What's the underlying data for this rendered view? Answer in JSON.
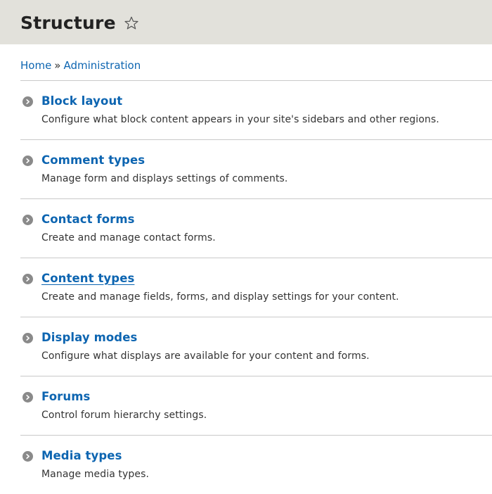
{
  "header": {
    "title": "Structure"
  },
  "breadcrumb": {
    "home": "Home",
    "separator": "»",
    "administration": "Administration"
  },
  "items": [
    {
      "title": "Block layout",
      "description": "Configure what block content appears in your site's sidebars and other regions."
    },
    {
      "title": "Comment types",
      "description": "Manage form and displays settings of comments."
    },
    {
      "title": "Contact forms",
      "description": "Create and manage contact forms."
    },
    {
      "title": "Content types",
      "description": "Create and manage fields, forms, and display settings for your content."
    },
    {
      "title": "Display modes",
      "description": "Configure what displays are available for your content and forms."
    },
    {
      "title": "Forums",
      "description": "Control forum hierarchy settings."
    },
    {
      "title": "Media types",
      "description": "Manage media types."
    }
  ],
  "colors": {
    "link": "#0d65b1",
    "header_bg": "#e2e1db",
    "icon": "#8a8a8a"
  },
  "icons": {
    "favorite": "star-outline-icon",
    "item_bullet": "chevron-circle-right-icon"
  }
}
